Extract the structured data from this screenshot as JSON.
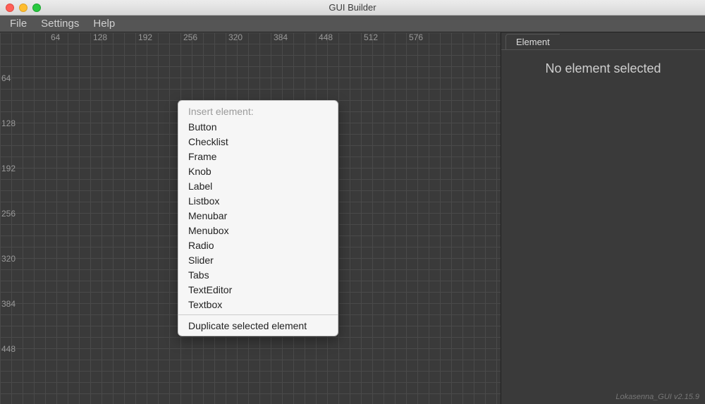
{
  "window": {
    "title": "GUI Builder"
  },
  "menubar": {
    "items": [
      "File",
      "Settings",
      "Help"
    ]
  },
  "ruler": {
    "h": [
      "64",
      "128",
      "192",
      "256",
      "320",
      "384",
      "448",
      "512",
      "576"
    ],
    "v": [
      "64",
      "128",
      "192",
      "256",
      "320",
      "384",
      "448"
    ]
  },
  "context_menu": {
    "heading": "Insert element:",
    "items": [
      "Button",
      "Checklist",
      "Frame",
      "Knob",
      "Label",
      "Listbox",
      "Menubar",
      "Menubox",
      "Radio",
      "Slider",
      "Tabs",
      "TextEditor",
      "Textbox"
    ],
    "duplicate": "Duplicate selected element"
  },
  "sidepanel": {
    "tab": "Element",
    "message": "No element selected"
  },
  "footer": "Lokasenna_GUI v2.15.9",
  "colors": {
    "bg": "#3a3a3a",
    "grid_minor": "#4a4a4a",
    "grid_major": "#606060",
    "menu_bg": "#555"
  }
}
